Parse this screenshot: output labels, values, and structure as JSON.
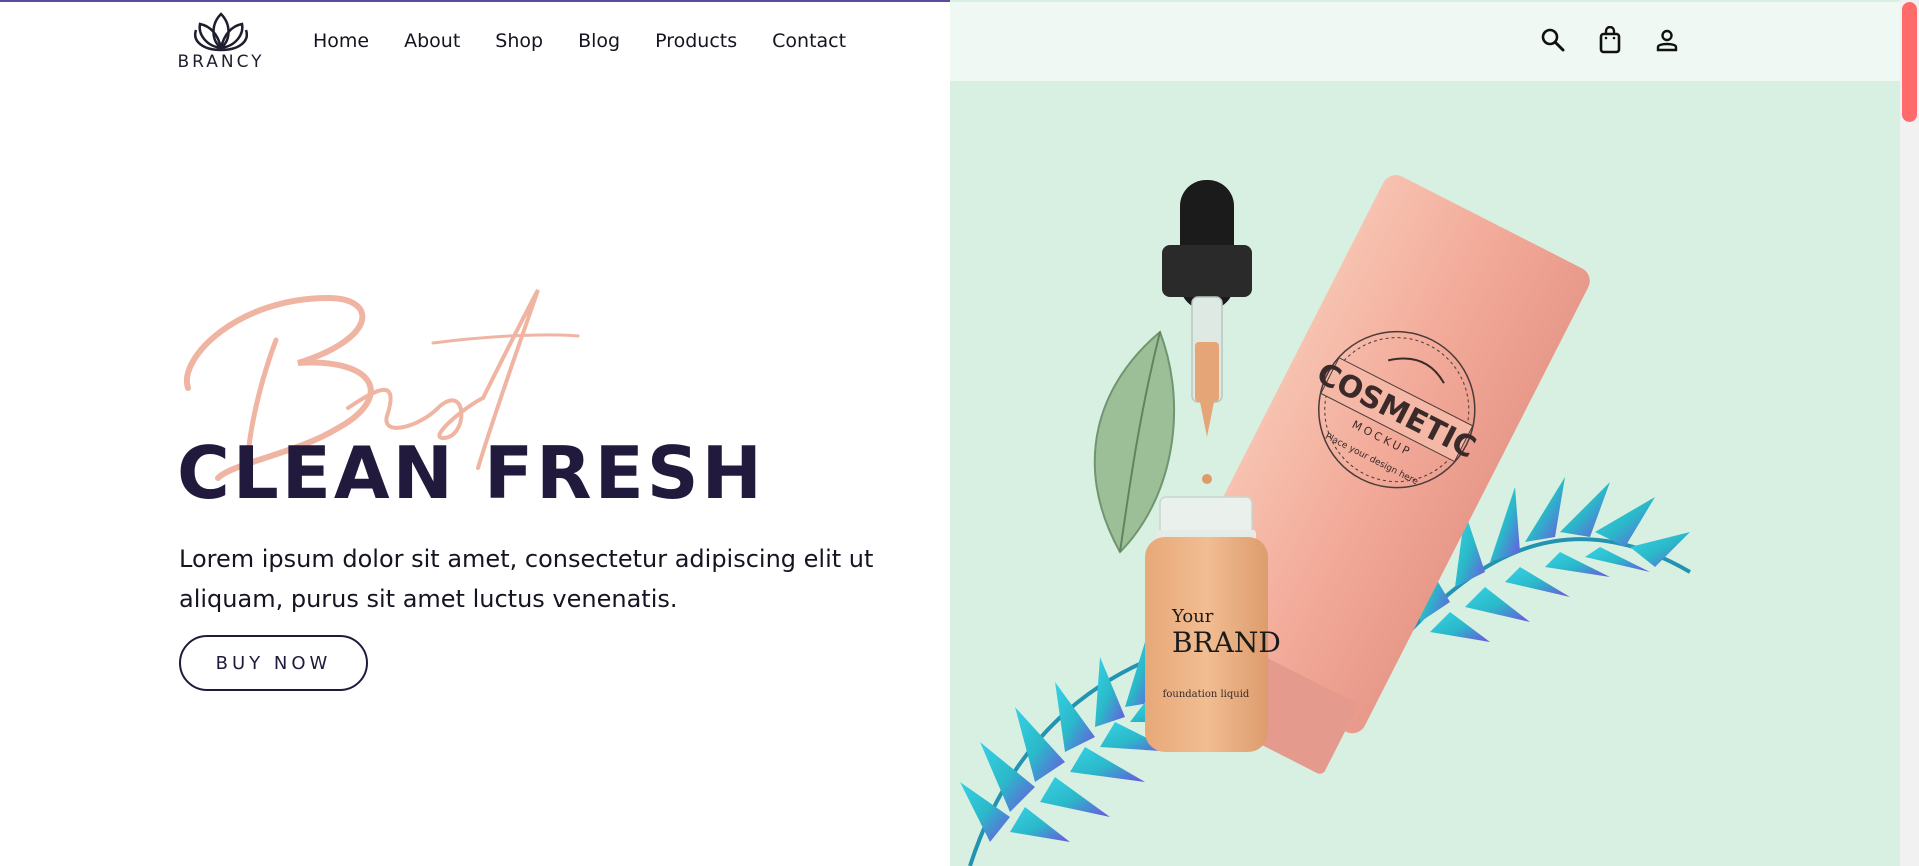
{
  "brand": {
    "name": "BRANCY"
  },
  "nav": {
    "items": [
      {
        "label": "Home"
      },
      {
        "label": "About"
      },
      {
        "label": "Shop"
      },
      {
        "label": "Blog"
      },
      {
        "label": "Products"
      },
      {
        "label": "Contact"
      }
    ]
  },
  "header_icons": [
    "search-icon",
    "shopping-bag-icon",
    "user-icon"
  ],
  "hero": {
    "script_word": "Best",
    "headline": "CLEAN FRESH",
    "description": "Lorem ipsum dolor sit amet, consectetur adipiscing elit ut aliquam, purus sit amet luctus venenatis.",
    "cta_label": "BUY NOW"
  },
  "product_image": {
    "tube_title": "COSMETIC",
    "tube_subtitle": "MOCKUP",
    "tube_note": "Place your design here",
    "bottle_brand_top": "Your",
    "bottle_brand": "BRAND",
    "bottle_note": "foundation liquid"
  },
  "colors": {
    "accent_dark": "#211a3d",
    "script_peach": "#f0b4a2",
    "panel_mint": "#d8f0e2",
    "scroll_thumb": "#ff6b6b"
  }
}
